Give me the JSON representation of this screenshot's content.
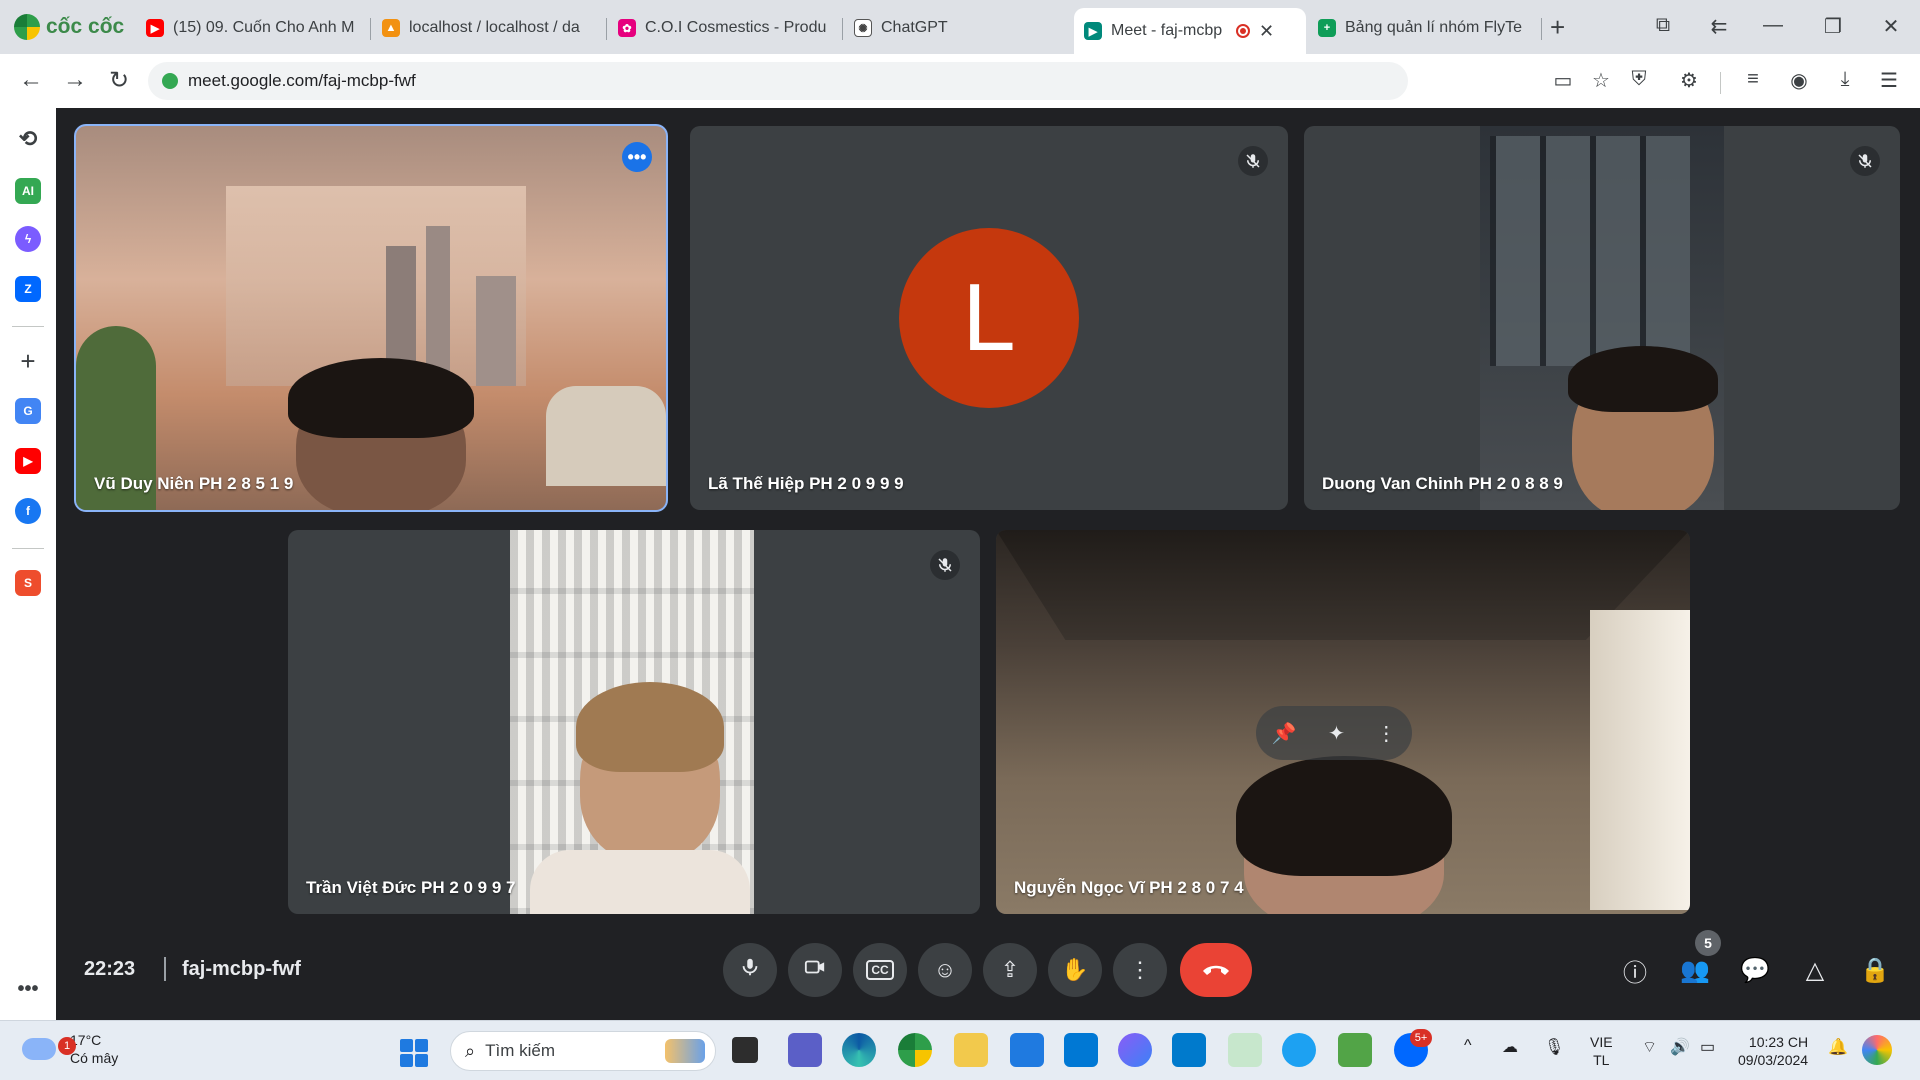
{
  "browser": {
    "brand": "cốc cốc",
    "tabs": [
      {
        "title": "(15) 09. Cuốn Cho Anh M",
        "icon": "youtube-icon"
      },
      {
        "title": "localhost / localhost / da",
        "icon": "phpmyadmin-icon"
      },
      {
        "title": "C.O.I Cosmestics - Produ",
        "icon": "cosmetics-icon"
      },
      {
        "title": "ChatGPT",
        "icon": "chatgpt-icon"
      },
      {
        "title": "Meet - faj-mcbp",
        "icon": "google-meet-icon",
        "active": true,
        "recording": true
      },
      {
        "title": "Bảng quản lí nhóm FlyTe",
        "icon": "google-sheets-icon"
      }
    ],
    "url": "meet.google.com/faj-mcbp-fwf"
  },
  "meet": {
    "participants": [
      {
        "name": "Vũ Duy Niên PH 2 8 5 1 9",
        "muted": false,
        "video": true,
        "active_speaker": true
      },
      {
        "name": "Lã Thế Hiệp PH 2 0 9 9 9",
        "muted": true,
        "video": false,
        "avatar_letter": "L",
        "avatar_color": "#c5380d"
      },
      {
        "name": "Duong Van Chinh PH 2 0 8 8 9",
        "muted": true,
        "video": true
      },
      {
        "name": "Trần Việt Đức PH 2 0 9 9 7",
        "muted": true,
        "video": true
      },
      {
        "name": "Nguyễn Ngọc Vĩ PH 2 8 0 7 4",
        "muted": false,
        "video": true,
        "hover_controls": [
          "pin-icon",
          "effects-icon",
          "more-vert-icon"
        ]
      }
    ],
    "time": "22:23",
    "meeting_code": "faj-mcbp-fwf",
    "participant_count": "5",
    "controls": [
      "mic-icon",
      "camera-icon",
      "captions-icon",
      "emoji-icon",
      "present-icon",
      "raise-hand-icon",
      "more-options-icon",
      "end-call-icon"
    ],
    "right_controls": [
      "info-icon",
      "people-icon",
      "chat-icon",
      "activities-icon",
      "host-controls-icon"
    ]
  },
  "taskbar": {
    "weather_temp": "17°C",
    "weather_cond": "Có mây",
    "weather_badge": "1",
    "search_placeholder": "Tìm kiếm",
    "lang_top": "VIE",
    "lang_bottom": "TL",
    "time": "10:23 CH",
    "date": "09/03/2024",
    "zalo_badge": "5+"
  }
}
